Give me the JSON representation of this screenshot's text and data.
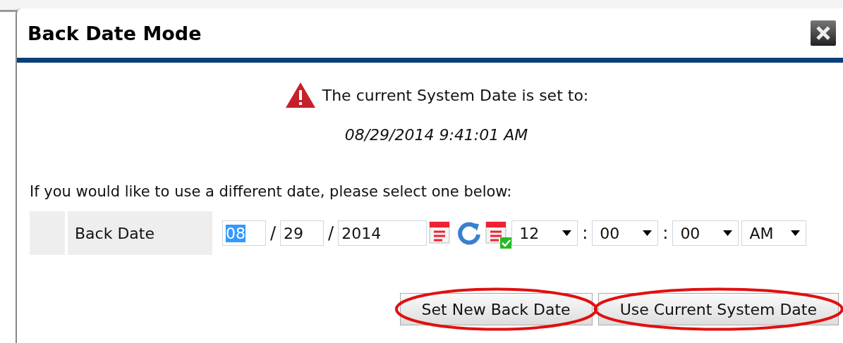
{
  "dialog": {
    "title": "Back Date Mode",
    "notice": "The current System Date is set to:",
    "system_date": "08/29/2014 9:41:01 AM",
    "instruction": "If you would like to use a different date, please select one below:",
    "back_date": {
      "label": "Back Date",
      "month": "08",
      "month_selected": true,
      "day": "29",
      "year": "2014",
      "separator": "/",
      "time": [
        {
          "value": "12"
        },
        {
          "value": "00"
        },
        {
          "value": "00"
        },
        {
          "value": "AM"
        }
      ],
      "time_separator": ":"
    },
    "buttons": [
      {
        "label": "Set New Back Date",
        "circled": true
      },
      {
        "label": "Use Current System Date",
        "circled": true
      }
    ]
  }
}
